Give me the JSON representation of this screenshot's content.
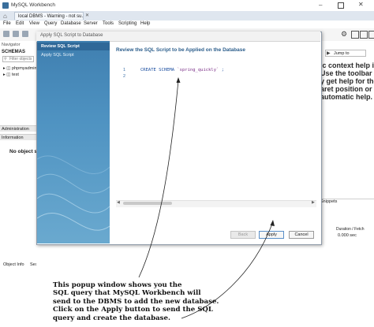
{
  "window": {
    "title": "MySQL Workbench",
    "connection_tab": "local DBMS - Warning - not su..."
  },
  "menu": [
    "File",
    "Edit",
    "View",
    "Query",
    "Database",
    "Server",
    "Tools",
    "Scripting",
    "Help"
  ],
  "navigator": {
    "header": "Navigator",
    "schemas_label": "SCHEMAS",
    "filter_placeholder": "Filter objects",
    "schemas": [
      "phpmyadmin",
      "test"
    ],
    "administration_tab": "Administration",
    "information_label": "Information",
    "no_object": "No object se",
    "object_info_tab": "Object Info",
    "session_tab": "Session"
  },
  "help_panel": {
    "jump_to": "Jump to",
    "lines": [
      "ic context help is",
      "Use the toolbar to",
      "y get help for the",
      "aret position or to",
      "automatic help."
    ]
  },
  "output": {
    "snippets_tab": "Snippets",
    "duration_header": "Duration / Fetch",
    "duration_value": "0.000 sec"
  },
  "dialog": {
    "title": "Apply SQL Script to Database",
    "steps": [
      "Review SQL Script",
      "Apply SQL Script"
    ],
    "heading": "Review the SQL Script to be Applied on the Database",
    "line_numbers": [
      "1",
      "2"
    ],
    "sql_keyword": "CREATE SCHEMA",
    "sql_name": "`spring_quickly`",
    "sql_end": " ;",
    "buttons": {
      "back": "Back",
      "apply": "Apply",
      "cancel": "Cancel"
    }
  },
  "annotation": {
    "lines": [
      "This popup window shows you the",
      "SQL query that MySQL Workbench will",
      "send to the DBMS to add the new database.",
      "Click on the Apply button to send the SQL",
      "query and create the database."
    ]
  }
}
